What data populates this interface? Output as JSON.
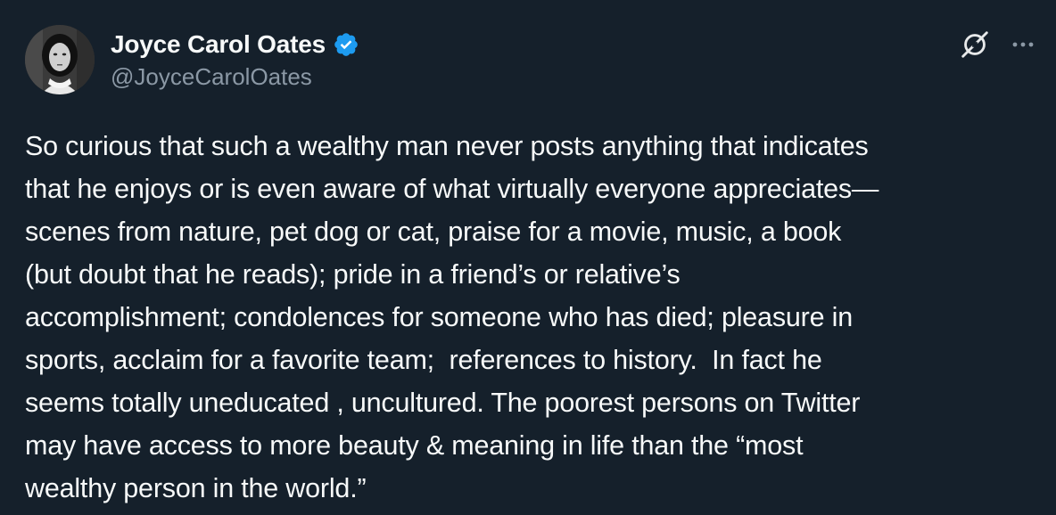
{
  "author": {
    "display_name": "Joyce Carol Oates",
    "handle": "@JoyceCarolOates",
    "verified": true,
    "avatar_icon": "profile-photo"
  },
  "header_actions": {
    "grok_icon": "grok-icon",
    "more_icon": "more-options-icon"
  },
  "colors": {
    "background": "#15202b",
    "text_primary": "#f7f9f9",
    "text_secondary": "#8b98a5",
    "verified_badge": "#1d9bf0"
  },
  "tweet": {
    "text": "So curious that such a wealthy man never posts anything that indicates\nthat he enjoys or is even aware of what virtually everyone appreciates—\nscenes from nature, pet dog or cat, praise for a movie, music, a book\n(but doubt that he reads); pride in a friend’s or relative’s\naccomplishment; condolences for someone who has died; pleasure in\nsports, acclaim for a favorite team;  references to history.  In fact he\nseems totally uneducated , uncultured. The poorest persons on Twitter\nmay have access to more beauty & meaning in life than the “most\nwealthy person in the world.”"
  }
}
